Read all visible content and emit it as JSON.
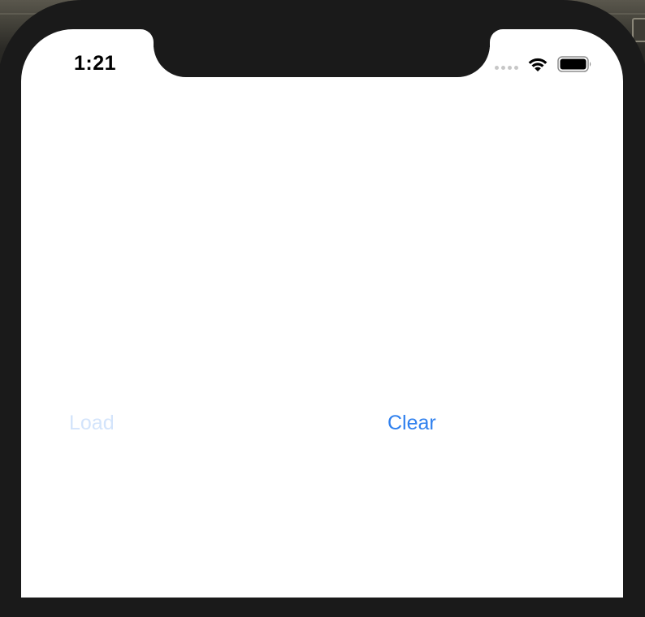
{
  "status_bar": {
    "time": "1:21",
    "icons": [
      "cellular-signal-icon",
      "wifi-icon",
      "battery-icon"
    ]
  },
  "buttons": {
    "load": {
      "label": "Load",
      "state": "disabled"
    },
    "clear": {
      "label": "Clear",
      "state": "enabled"
    }
  },
  "colors": {
    "accent": "#2f80ee",
    "disabled_accent": "#d3e4fb",
    "frame": "#1a1a1a",
    "screen": "#ffffff"
  }
}
